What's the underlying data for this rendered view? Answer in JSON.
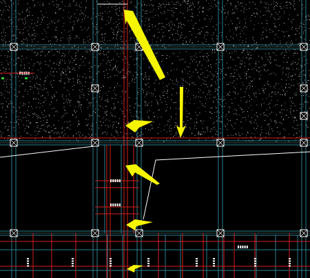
{
  "drawing": {
    "background_color": "#000000",
    "hatch_color": "#e8e8e8",
    "grid_line_color": "#2a7f8f",
    "grid_line_highlight_color": "#9fe6ee",
    "beam_color": "#d81e1e",
    "annotation_line_color": "#ffffff",
    "arrow_color": "#f5f500",
    "dimension_text_color": "#ffffff",
    "label_marker_color": "#2bd12b"
  },
  "annotations": {
    "arrows": [
      {
        "name": "arrow-1",
        "direction": "up-left"
      },
      {
        "name": "arrow-2",
        "direction": "left"
      },
      {
        "name": "arrow-3",
        "direction": "down"
      },
      {
        "name": "arrow-4",
        "direction": "up-left"
      },
      {
        "name": "arrow-5",
        "direction": "left"
      },
      {
        "name": "arrow-6",
        "direction": "left"
      }
    ]
  }
}
